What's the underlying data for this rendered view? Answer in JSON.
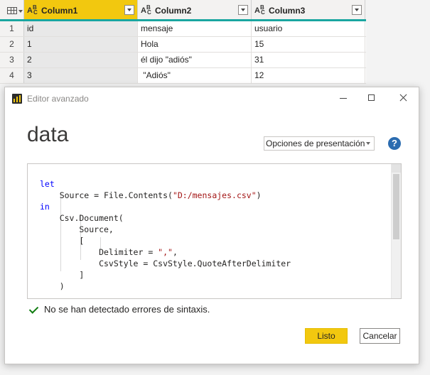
{
  "grid": {
    "columns": [
      {
        "name": "Column1",
        "type_icon": "abc-text-type-icon"
      },
      {
        "name": "Column2",
        "type_icon": "abc-text-type-icon"
      },
      {
        "name": "Column3",
        "type_icon": "abc-text-type-icon"
      }
    ],
    "rows": [
      {
        "num": "1",
        "cells": [
          "id",
          "mensaje",
          "usuario"
        ]
      },
      {
        "num": "2",
        "cells": [
          "1",
          "Hola",
          "15"
        ]
      },
      {
        "num": "3",
        "cells": [
          "2",
          "él dijo \"adiós\"",
          "31"
        ]
      },
      {
        "num": "4",
        "cells": [
          "3",
          " \"Adiós\"",
          "12"
        ]
      }
    ]
  },
  "dialog": {
    "title": "Editor avanzado",
    "query_name": "data",
    "display_options_label": "Opciones de presentación",
    "help_symbol": "?",
    "code_lines": [
      "let",
      "    Source = File.Contents(\"D:/mensajes.csv\")",
      "in",
      "    Csv.Document(",
      "        Source,",
      "        [",
      "            Delimiter = \",\",",
      "            CsvStyle = CsvStyle.QuoteAfterDelimiter",
      "        ]",
      "    )"
    ],
    "status_text": "No se han detectado errores de sintaxis.",
    "ok_label": "Listo",
    "cancel_label": "Cancelar"
  },
  "colors": {
    "accent_yellow": "#f2c80f",
    "header_underline": "#1aa6a0",
    "keyword_blue": "#0000ff",
    "string_red": "#a31515",
    "success_green": "#107c10"
  }
}
